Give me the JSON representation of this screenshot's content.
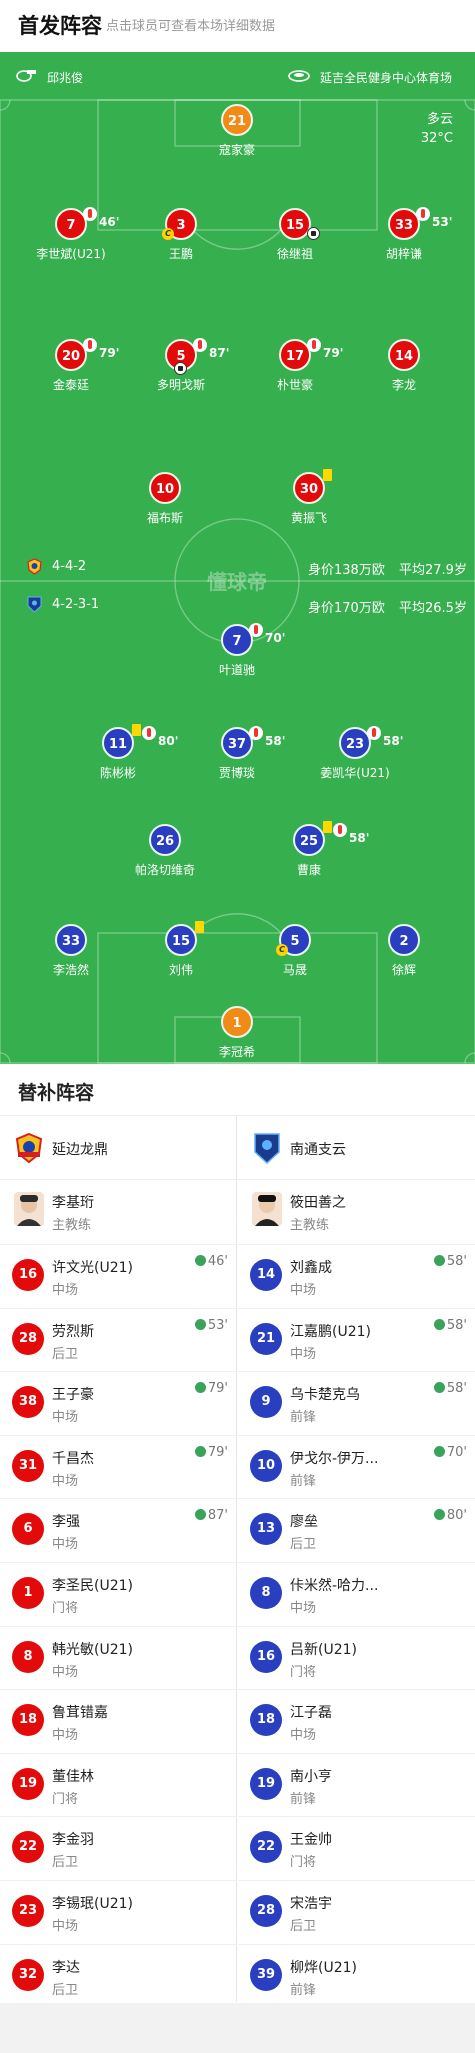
{
  "header": {
    "title": "首发阵容",
    "subtitle": "点击球员可查看本场详细数据"
  },
  "match_info": {
    "referee": "邱兆俊",
    "stadium": "延吉全民健身中心体育场",
    "weather": "多云",
    "temperature": "32°C",
    "watermark": "懂球帝",
    "referee_icon": "whistle-icon",
    "stadium_icon": "stadium-icon"
  },
  "home_team": {
    "name": "延边龙鼎",
    "formation": "4-4-2",
    "value": "身价138万欧",
    "avg_age": "平均27.9岁",
    "color": "#e20a0a"
  },
  "away_team": {
    "name": "南通支云",
    "formation": "4-2-3-1",
    "value": "身价170万欧",
    "avg_age": "平均26.5岁",
    "color": "#2a3fbf"
  },
  "home_lineup": [
    {
      "num": "21",
      "name": "寇家豪",
      "gk": true
    },
    {
      "num": "7",
      "name": "李世斌(U21)",
      "sub_min": "46'"
    },
    {
      "num": "3",
      "name": "王鹏",
      "captain": "C"
    },
    {
      "num": "15",
      "name": "徐继祖",
      "goal": true
    },
    {
      "num": "33",
      "name": "胡梓谦",
      "sub_min": "53'"
    },
    {
      "num": "20",
      "name": "金泰廷",
      "sub_min": "79'"
    },
    {
      "num": "5",
      "name": "多明戈斯",
      "sub_min": "87'",
      "goal": true
    },
    {
      "num": "17",
      "name": "朴世豪",
      "sub_min": "79'"
    },
    {
      "num": "14",
      "name": "李龙"
    },
    {
      "num": "10",
      "name": "福布斯"
    },
    {
      "num": "30",
      "name": "黄振飞",
      "yellow": true
    }
  ],
  "away_lineup": [
    {
      "num": "7",
      "name": "叶道驰",
      "sub_min": "70'"
    },
    {
      "num": "11",
      "name": "陈彬彬",
      "yellow": true,
      "sub_min": "80'"
    },
    {
      "num": "37",
      "name": "贾博琰",
      "sub_min": "58'"
    },
    {
      "num": "23",
      "name": "姜凯华(U21)",
      "sub_min": "58'"
    },
    {
      "num": "26",
      "name": "帕洛切维奇"
    },
    {
      "num": "25",
      "name": "曹康",
      "yellow": true,
      "sub_min": "58'"
    },
    {
      "num": "33",
      "name": "李浩然"
    },
    {
      "num": "15",
      "name": "刘伟",
      "yellow": true
    },
    {
      "num": "5",
      "name": "马晟",
      "captain": "C"
    },
    {
      "num": "2",
      "name": "徐辉"
    },
    {
      "num": "1",
      "name": "李冠希",
      "gk": true
    }
  ],
  "subs_header": {
    "title": "替补阵容"
  },
  "home_subs": {
    "coach": {
      "name": "李基珩",
      "role": "主教练"
    },
    "players": [
      {
        "num": "16",
        "name": "许文光(U21)",
        "pos": "中场",
        "in": "46'"
      },
      {
        "num": "28",
        "name": "劳烈斯",
        "pos": "后卫",
        "in": "53'"
      },
      {
        "num": "38",
        "name": "王子豪",
        "pos": "中场",
        "in": "79'"
      },
      {
        "num": "31",
        "name": "千昌杰",
        "pos": "中场",
        "in": "79'"
      },
      {
        "num": "6",
        "name": "李强",
        "pos": "中场",
        "in": "87'"
      },
      {
        "num": "1",
        "name": "李圣民(U21)",
        "pos": "门将"
      },
      {
        "num": "8",
        "name": "韩光敏(U21)",
        "pos": "中场"
      },
      {
        "num": "18",
        "name": "鲁茸错嘉",
        "pos": "中场"
      },
      {
        "num": "19",
        "name": "董佳林",
        "pos": "门将"
      },
      {
        "num": "22",
        "name": "李金羽",
        "pos": "后卫"
      },
      {
        "num": "23",
        "name": "李锡珉(U21)",
        "pos": "中场"
      },
      {
        "num": "32",
        "name": "李达",
        "pos": "后卫"
      }
    ]
  },
  "away_subs": {
    "coach": {
      "name": "筱田善之",
      "role": "主教练"
    },
    "players": [
      {
        "num": "14",
        "name": "刘鑫成",
        "pos": "中场",
        "in": "58'"
      },
      {
        "num": "21",
        "name": "江嘉鹏(U21)",
        "pos": "中场",
        "in": "58'"
      },
      {
        "num": "9",
        "name": "乌卡楚克乌",
        "pos": "前锋",
        "in": "58'"
      },
      {
        "num": "10",
        "name": "伊戈尔-伊万...",
        "pos": "前锋",
        "in": "70'"
      },
      {
        "num": "13",
        "name": "廖垒",
        "pos": "后卫",
        "in": "80'"
      },
      {
        "num": "8",
        "name": "佧米然-哈力...",
        "pos": "中场"
      },
      {
        "num": "16",
        "name": "吕新(U21)",
        "pos": "门将"
      },
      {
        "num": "18",
        "name": "江子磊",
        "pos": "中场"
      },
      {
        "num": "19",
        "name": "南小亨",
        "pos": "前锋"
      },
      {
        "num": "22",
        "name": "王金帅",
        "pos": "门将"
      },
      {
        "num": "28",
        "name": "宋浩宇",
        "pos": "后卫"
      },
      {
        "num": "39",
        "name": "柳烨(U21)",
        "pos": "前锋"
      }
    ]
  }
}
